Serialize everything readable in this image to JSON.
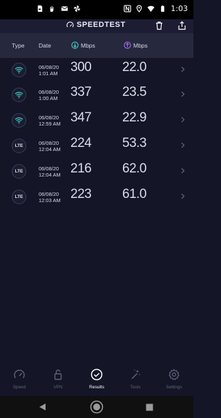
{
  "status_bar": {
    "time": "1:03"
  },
  "app": {
    "title": "SPEEDTEST"
  },
  "table_header": {
    "type": "Type",
    "date": "Date",
    "download": "Mbps",
    "upload": "Mbps"
  },
  "results": [
    {
      "connection": "wifi",
      "date": "06/08/20",
      "time": "1:01 AM",
      "download": "300",
      "upload": "22.0"
    },
    {
      "connection": "wifi",
      "date": "06/08/20",
      "time": "1:00 AM",
      "download": "337",
      "upload": "23.5"
    },
    {
      "connection": "wifi",
      "date": "06/08/20",
      "time": "12:59 AM",
      "download": "347",
      "upload": "22.9"
    },
    {
      "connection": "lte",
      "label": "LTE",
      "date": "06/08/20",
      "time": "12:04 AM",
      "download": "224",
      "upload": "53.3"
    },
    {
      "connection": "lte",
      "label": "LTE",
      "date": "06/08/20",
      "time": "12:04 AM",
      "download": "216",
      "upload": "62.0"
    },
    {
      "connection": "lte",
      "label": "LTE",
      "date": "06/08/20",
      "time": "12:03 AM",
      "download": "223",
      "upload": "61.0"
    }
  ],
  "bottom_nav": [
    {
      "label": "Speed",
      "icon": "speed-icon",
      "active": false
    },
    {
      "label": "VPN",
      "icon": "lock-icon",
      "active": false
    },
    {
      "label": "Results",
      "icon": "results-check-icon",
      "active": true
    },
    {
      "label": "Tools",
      "icon": "magic-wand-icon",
      "active": false
    },
    {
      "label": "Settings",
      "icon": "gear-icon",
      "active": false
    }
  ],
  "colors": {
    "background": "#141526",
    "header": "#26283d",
    "wifi": "#3fd1c7",
    "download": "#3fd1c7",
    "upload": "#a36cf0"
  }
}
